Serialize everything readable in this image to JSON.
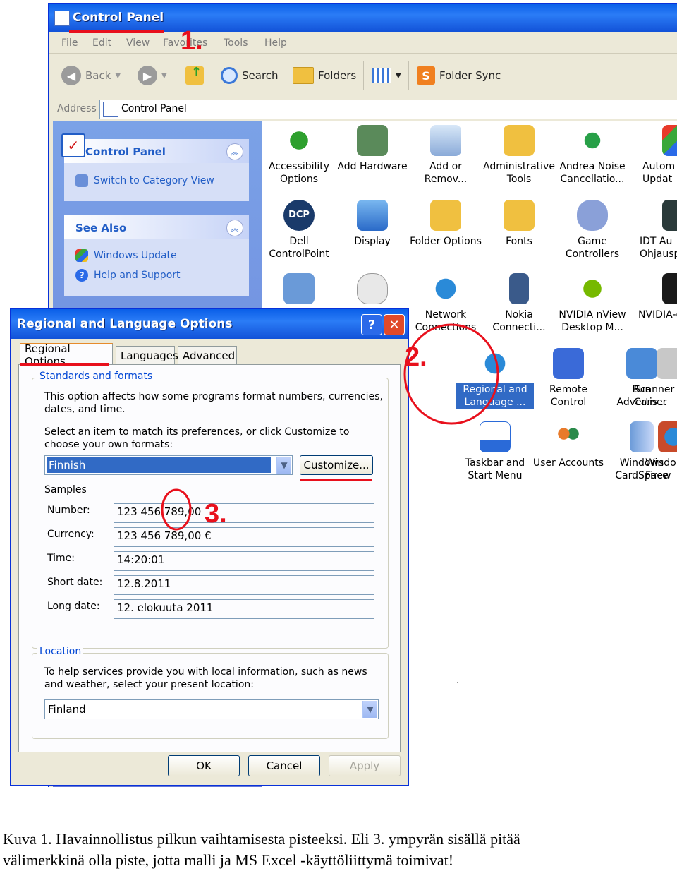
{
  "control_panel": {
    "title": "Control Panel",
    "menu": [
      "File",
      "Edit",
      "View",
      "Favorites",
      "Tools",
      "Help"
    ],
    "toolbar": {
      "back": "Back",
      "search": "Search",
      "folders": "Folders",
      "folder_sync": "Folder Sync"
    },
    "address": {
      "label": "Address",
      "value": "Control Panel"
    },
    "sidebar": {
      "panel_title": "Control Panel",
      "switch_view": "Switch to Category View",
      "see_also_title": "See Also",
      "see_also": [
        "Windows Update",
        "Help and Support"
      ]
    },
    "icons": {
      "row1": [
        "Accessibility\nOptions",
        "Add Hardware",
        "Add or\nRemov...",
        "Administrative\nTools",
        "Andrea Noise\nCancellatio...",
        "Autom\nUpdat"
      ],
      "row2": [
        "Dell\nControlPoint",
        "Display",
        "Folder Options",
        "Fonts",
        "Game\nControllers",
        "IDT Au\nOhjausp"
      ],
      "row3": [
        "Network\nConnections",
        "Nokia\nConnecti...",
        "NVIDIA nView\nDesktop M...",
        "NVIDIA-o"
      ],
      "row4": [
        "Regional and\nLanguage ...",
        "Remote\nControl",
        "Run\nAdvertis...",
        "Scanner\nCamer"
      ],
      "row5": [
        "Taskbar and\nStart Menu",
        "User Accounts",
        "Windows\nCardSpace",
        "Windo\nFirew"
      ]
    },
    "dcp_badge": "DCP"
  },
  "dialog": {
    "title": "Regional and Language Options",
    "help": "?",
    "close": "✕",
    "tabs": [
      "Regional Options",
      "Languages",
      "Advanced"
    ],
    "standards": {
      "legend": "Standards and formats",
      "desc": "This option affects how some programs format numbers, currencies, dates, and time.",
      "select_text": "Select an item to match its preferences, or click Customize to choose your own formats:",
      "selected": "Finnish",
      "customize": "Customize...",
      "samples_label": "Samples",
      "samples": [
        {
          "label": "Number:",
          "value": "123 456 789,00"
        },
        {
          "label": "Currency:",
          "value": "123 456 789,00 €"
        },
        {
          "label": "Time:",
          "value": "14:20:01"
        },
        {
          "label": "Short date:",
          "value": "12.8.2011"
        },
        {
          "label": "Long date:",
          "value": "12. elokuuta 2011"
        }
      ]
    },
    "location": {
      "legend": "Location",
      "desc": "To help services provide you with local information, such as news and weather, select your present location:",
      "selected": "Finland"
    },
    "buttons": {
      "ok": "OK",
      "cancel": "Cancel",
      "apply": "Apply"
    }
  },
  "annotations": {
    "marker1": "1.",
    "marker2": "2.",
    "marker3": "3.",
    "color": "#e8101c"
  },
  "caption": {
    "line1": "Kuva 1. Havainnollistus pilkun vaihtamisesta pisteeksi. Eli 3. ympyrän sisällä pitää",
    "line2": "välimerkkinä olla piste, jotta malli ja MS Excel -käyttöliittymä toimivat!"
  }
}
